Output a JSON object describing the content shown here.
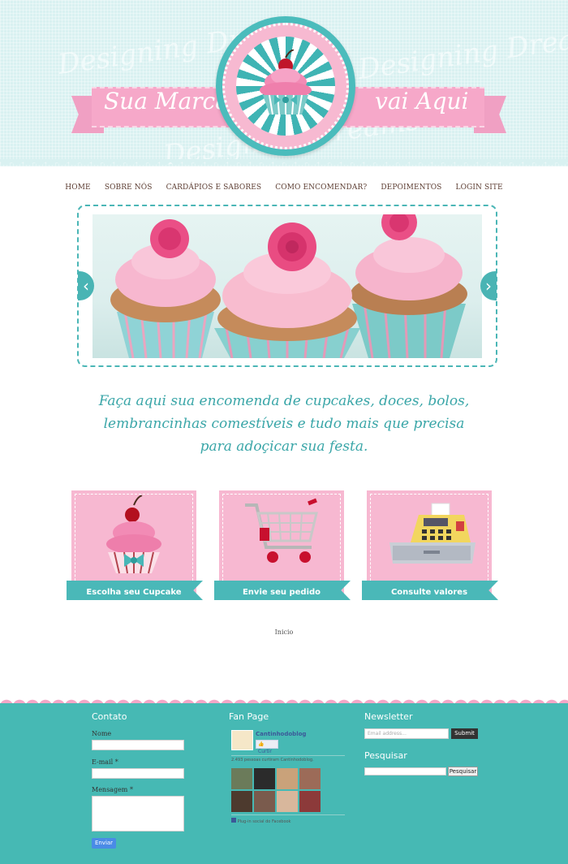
{
  "header": {
    "watermark": "Designing Dreams",
    "brand_left": "Sua Marca",
    "brand_right": "vai Aqui"
  },
  "nav": {
    "items": [
      "HOME",
      "SOBRE NÓS",
      "CARDÁPIOS E SABORES",
      "COMO ENCOMENDAR?",
      "DEPOIMENTOS",
      "LOGIN SITE"
    ]
  },
  "slider": {
    "prev_icon": "chevron-left-icon",
    "next_icon": "chevron-right-icon"
  },
  "tagline": {
    "line1": "Faça aqui sua encomenda de cupcakes, doces, bolos,",
    "line2": "lembrancinhas comestíveis e tudo mais que precisa",
    "line3": "para adoçicar sua festa."
  },
  "cards": [
    {
      "label": "Escolha seu Cupcake",
      "icon": "cupcake-icon"
    },
    {
      "label": "Envie seu pedido",
      "icon": "shopping-cart-icon"
    },
    {
      "label": "Consulte valores",
      "icon": "cash-register-icon"
    }
  ],
  "breadcrumb": "Inicio",
  "footer": {
    "contact": {
      "title": "Contato",
      "name_label": "Nome",
      "email_label": "E-mail *",
      "message_label": "Mensagem *",
      "submit_label": "Enviar"
    },
    "fanpage": {
      "title": "Fan Page",
      "page_name": "Cantinhodoblog",
      "like_label": "Curtir",
      "likes_text": "2.493 pessoas curtiram Cantinhodoblog.",
      "plugin_text": "Plug-in social do Facebook"
    },
    "newsletter": {
      "title": "Newsletter",
      "placeholder": "Email address...",
      "submit_label": "Submit"
    },
    "search": {
      "title": "Pesquisar",
      "button_label": "Pesquisar"
    }
  },
  "colors": {
    "teal": "#46b9b4",
    "pink": "#f7b8d1",
    "header_bg": "#d9f1f1",
    "nav_text": "#5d3e33"
  }
}
